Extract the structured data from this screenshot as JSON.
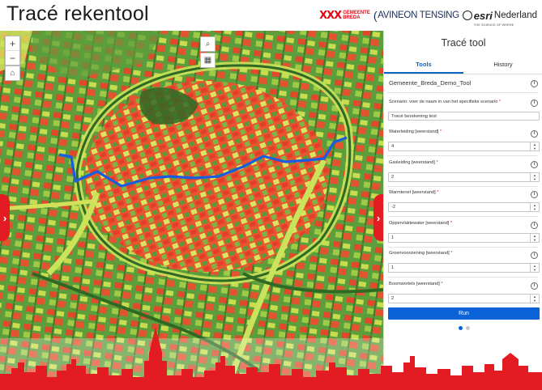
{
  "header": {
    "title": "Tracé rekentool",
    "logos": {
      "gemeente_mark": "XXX",
      "gemeente_line1": "GEMEENTE",
      "gemeente_line2": "BREDA",
      "avineon": "AVINEON TENSING",
      "esri": "esri",
      "esri_tagline": "THE SCIENCE OF WHERE",
      "esri_country": "Nederland"
    }
  },
  "map": {
    "controls": {
      "zoom_in": "+",
      "zoom_out": "−",
      "home": "⌂",
      "search": "⌕",
      "qr": "▦"
    },
    "side_tabs": {
      "left": "›",
      "right": "›"
    },
    "route_color": "#1a5be0"
  },
  "panel": {
    "title": "Tracé tool",
    "tabs": [
      "Tools",
      "History"
    ],
    "active_tab": "Tools",
    "tool_name": "Gemeente_Breda_Demo_Tool",
    "info_glyph": "i",
    "scenario": {
      "label": "Scenario: voer de naam in van het specifieke scenario",
      "value": "Tracé berekening test"
    },
    "fields": [
      {
        "label": "Waterleiding [weerstand]",
        "value": "4"
      },
      {
        "label": "Gasleiding [weerstand]",
        "value": "2"
      },
      {
        "label": "Warmtenet [weerstand]",
        "value": "-2"
      },
      {
        "label": "Oppervlaktewater [weerstand]",
        "value": "1"
      },
      {
        "label": "Groenvoorziening [weerstand]",
        "value": "1"
      },
      {
        "label": "Boomwortels [weerstand]",
        "value": "2"
      }
    ],
    "required_mark": "*",
    "run_label": "Run",
    "pages": 2,
    "active_page": 1
  },
  "colors": {
    "accent": "#0a63d8",
    "brand_red": "#e31b23"
  }
}
